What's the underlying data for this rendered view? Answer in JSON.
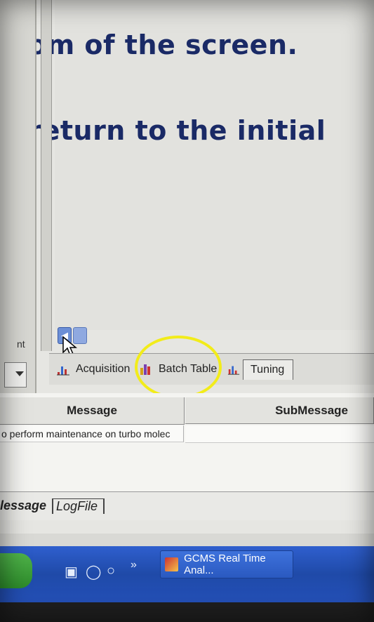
{
  "instructions": {
    "line1": "om of the screen.",
    "line2": "o return to the initial"
  },
  "left_panel": {
    "label_fragment": "nt"
  },
  "view_tabs": {
    "acquisition": "Acquisition",
    "batch_table": "Batch Table",
    "tuning": "Tuning",
    "selected": "Tuning"
  },
  "message_grid": {
    "columns": [
      "Message",
      "SubMessage"
    ],
    "rows": [
      [
        "o perform maintenance on turbo molec",
        ""
      ]
    ]
  },
  "bottom_tabs": {
    "message": "lessage",
    "logfile": "LogFile"
  },
  "taskbar": {
    "quick_launch_more": "»",
    "window_button": "GCMS Real Time Anal..."
  },
  "colors": {
    "instruction_text": "#1a2a66",
    "highlight_ring": "#f2ec1a",
    "taskbar": "#2450b8"
  }
}
